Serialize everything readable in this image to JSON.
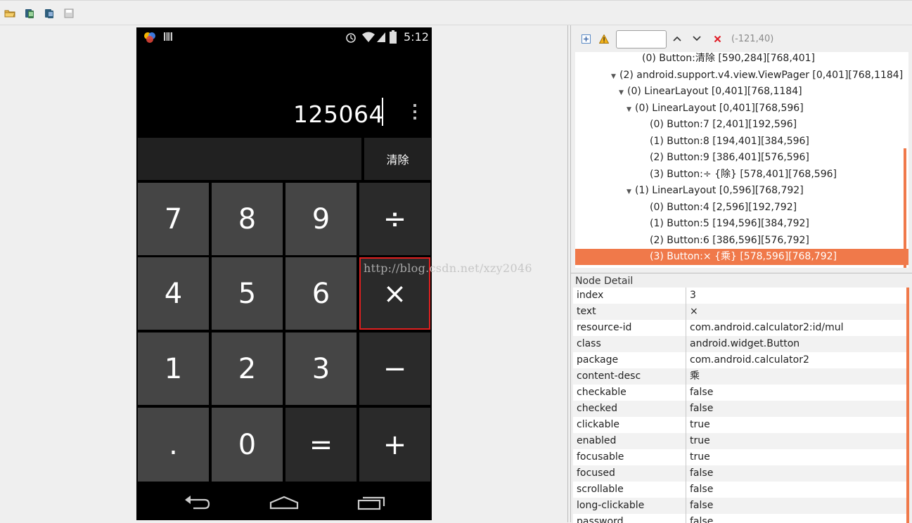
{
  "toolbar": {
    "icons": [
      "folder-open-icon",
      "device-screenshot-icon",
      "device-screenshot-compressed-icon",
      "save-icon"
    ]
  },
  "phone": {
    "status": {
      "time": "5:12"
    },
    "display": {
      "value": "125064"
    },
    "clear_label": "清除",
    "keys": [
      [
        "7",
        "8",
        "9",
        "÷"
      ],
      [
        "4",
        "5",
        "6",
        "×"
      ],
      [
        "1",
        "2",
        "3",
        "−"
      ],
      [
        ".",
        "0",
        "=",
        "+"
      ]
    ]
  },
  "watermark": "http://blog.csdn.net/xzy2046",
  "hierarchy": {
    "coords": "(-121,40)",
    "rows": [
      {
        "indent": 8,
        "arrow": "",
        "text": "(0) Button:清除 [590,284][768,401]"
      },
      {
        "indent": 4,
        "arrow": "▼",
        "text": "(2) android.support.v4.view.ViewPager [0,401][768,1184]"
      },
      {
        "indent": 5,
        "arrow": "▼",
        "text": "(0) LinearLayout [0,401][768,1184]"
      },
      {
        "indent": 6,
        "arrow": "▼",
        "text": "(0) LinearLayout [0,401][768,596]"
      },
      {
        "indent": 9,
        "arrow": "",
        "text": "(0) Button:7 [2,401][192,596]"
      },
      {
        "indent": 9,
        "arrow": "",
        "text": "(1) Button:8 [194,401][384,596]"
      },
      {
        "indent": 9,
        "arrow": "",
        "text": "(2) Button:9 [386,401][576,596]"
      },
      {
        "indent": 9,
        "arrow": "",
        "text": "(3) Button:÷ {除} [578,401][768,596]"
      },
      {
        "indent": 6,
        "arrow": "▼",
        "text": "(1) LinearLayout [0,596][768,792]"
      },
      {
        "indent": 9,
        "arrow": "",
        "text": "(0) Button:4 [2,596][192,792]"
      },
      {
        "indent": 9,
        "arrow": "",
        "text": "(1) Button:5 [194,596][384,792]"
      },
      {
        "indent": 9,
        "arrow": "",
        "text": "(2) Button:6 [386,596][576,792]"
      },
      {
        "indent": 9,
        "arrow": "",
        "text": "(3) Button:× {乘} [578,596][768,792]",
        "selected": true
      }
    ]
  },
  "detail": {
    "title": "Node Detail",
    "rows": [
      [
        "index",
        "3"
      ],
      [
        "text",
        "×"
      ],
      [
        "resource-id",
        "com.android.calculator2:id/mul"
      ],
      [
        "class",
        "android.widget.Button"
      ],
      [
        "package",
        "com.android.calculator2"
      ],
      [
        "content-desc",
        "乘"
      ],
      [
        "checkable",
        "false"
      ],
      [
        "checked",
        "false"
      ],
      [
        "clickable",
        "true"
      ],
      [
        "enabled",
        "true"
      ],
      [
        "focusable",
        "true"
      ],
      [
        "focused",
        "false"
      ],
      [
        "scrollable",
        "false"
      ],
      [
        "long-clickable",
        "false"
      ],
      [
        "password",
        "false"
      ]
    ]
  },
  "colors": {
    "selection": "#f0794a",
    "highlight_box": "#e02020"
  }
}
